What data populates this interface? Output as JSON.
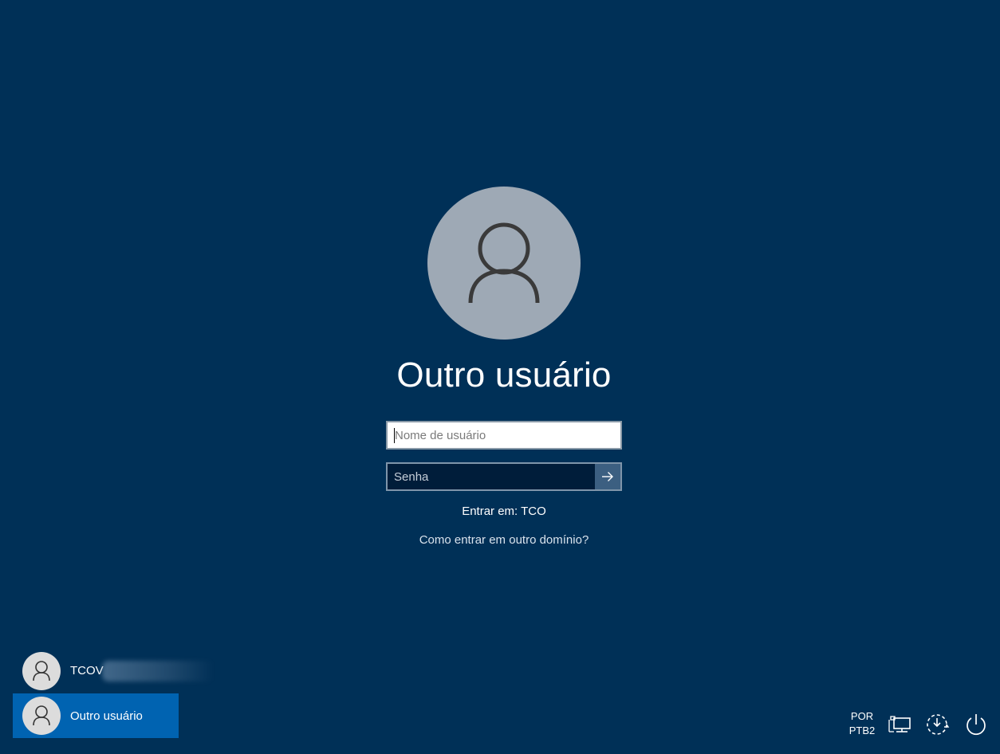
{
  "current_user": {
    "title": "Outro usuário"
  },
  "login_form": {
    "username_placeholder": "Nome de usuário",
    "password_placeholder": "Senha",
    "sign_in_to": "Entrar em: TCO",
    "other_domain_link": "Como entrar em outro domínio?"
  },
  "user_list": [
    {
      "label": "TCOV",
      "selected": false,
      "obscured": true
    },
    {
      "label": "Outro usuário",
      "selected": true
    }
  ],
  "taskbar": {
    "language_line1": "POR",
    "language_line2": "PTB2",
    "icons": [
      "network-icon",
      "ease-of-access-icon",
      "power-icon"
    ]
  },
  "colors": {
    "background": "#003057",
    "selection": "#0063b1",
    "avatar": "#9ea9b5"
  }
}
